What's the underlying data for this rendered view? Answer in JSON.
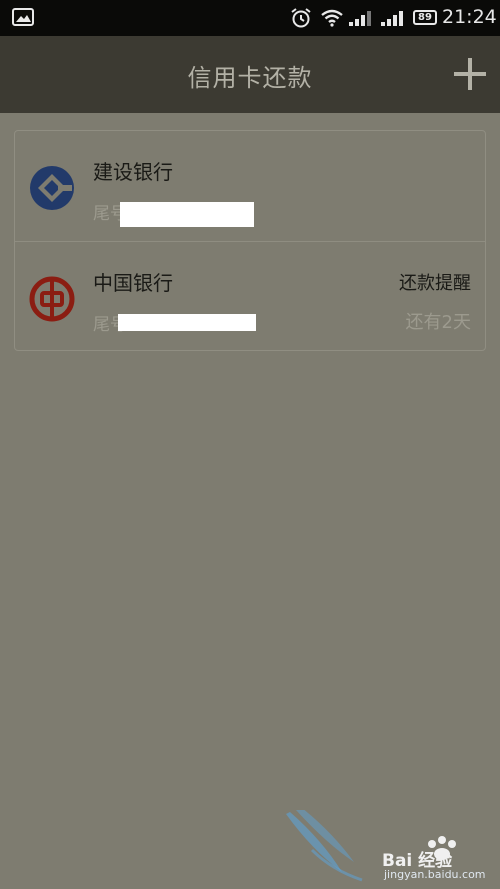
{
  "status_bar": {
    "time": "21:24",
    "battery": "89"
  },
  "header": {
    "title": "信用卡还款",
    "add_label": "+"
  },
  "cards": [
    {
      "bank": "建设银行",
      "subtitle": "尾号",
      "logo": "ccb-logo",
      "brand_color": "#223a6a"
    },
    {
      "bank": "中国银行",
      "subtitle": "尾号",
      "logo": "boc-logo",
      "brand_color": "#8b1d12",
      "reminder": "还款提醒",
      "days_left": "还有2天"
    }
  ],
  "watermark": {
    "text": "Bai 经验",
    "url": "jingyan.baidu.com"
  }
}
